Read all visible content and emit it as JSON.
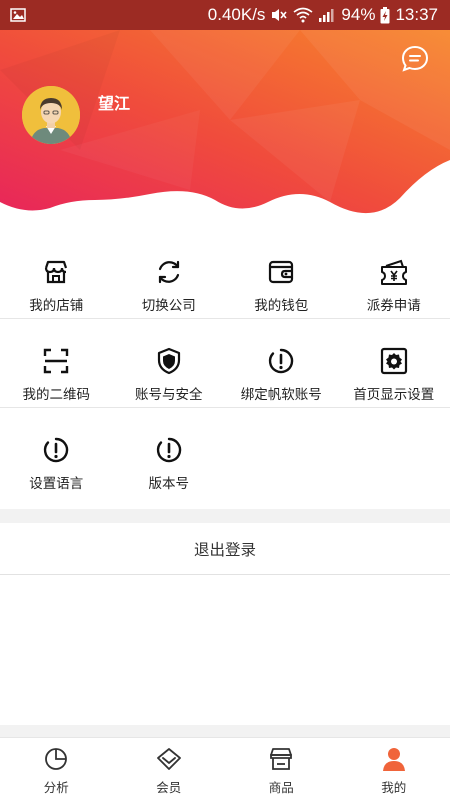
{
  "status_bar": {
    "speed": "0.40K/s",
    "battery": "94%",
    "time": "13:37"
  },
  "header": {
    "username": "望江",
    "message_icon": "chat-bubble-icon"
  },
  "menu": {
    "rows": [
      [
        {
          "label": "我的店铺",
          "icon": "store-icon"
        },
        {
          "label": "切换公司",
          "icon": "switch-icon"
        },
        {
          "label": "我的钱包",
          "icon": "wallet-icon"
        },
        {
          "label": "派券申请",
          "icon": "coupon-icon"
        }
      ],
      [
        {
          "label": "我的二维码",
          "icon": "qrcode-scan-icon"
        },
        {
          "label": "账号与安全",
          "icon": "shield-icon"
        },
        {
          "label": "绑定帆软账号",
          "icon": "exclamation-circle-icon"
        },
        {
          "label": "首页显示设置",
          "icon": "gear-icon"
        }
      ],
      [
        {
          "label": "设置语言",
          "icon": "exclamation-circle-icon"
        },
        {
          "label": "版本号",
          "icon": "exclamation-circle-icon"
        }
      ]
    ]
  },
  "logout_label": "退出登录",
  "bottom_nav": [
    {
      "label": "分析",
      "icon": "pie-chart-icon",
      "active": false
    },
    {
      "label": "会员",
      "icon": "diamond-icon",
      "active": false
    },
    {
      "label": "商品",
      "icon": "shop-icon",
      "active": false
    },
    {
      "label": "我的",
      "icon": "user-icon",
      "active": true
    }
  ],
  "colors": {
    "accent": "#f0643a",
    "gradient_start": "#e8265a",
    "gradient_end": "#f7862b",
    "status_bar": "#9c2b23",
    "avatar_bg": "#f0bf3c"
  }
}
